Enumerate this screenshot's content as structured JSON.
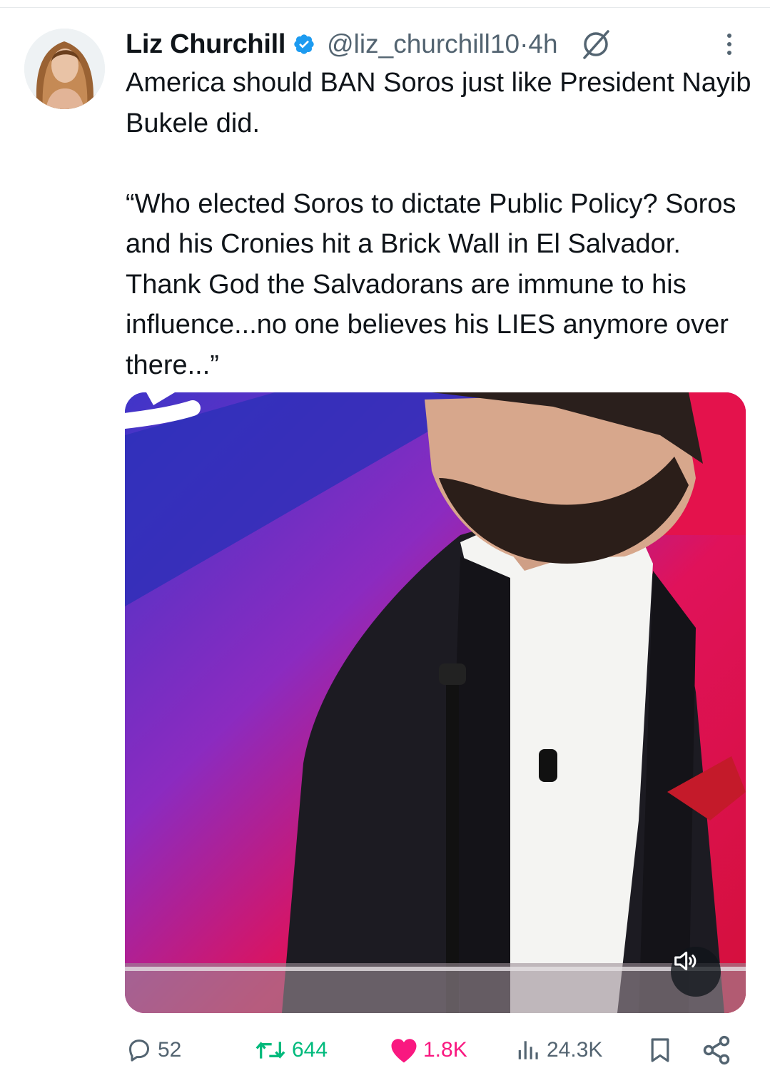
{
  "author": {
    "name": "Liz Churchill",
    "handle": "@liz_churchill10",
    "separator": " · ",
    "time": "4h"
  },
  "tweet": {
    "text": "America should BAN Soros just like President Nayib Bukele did.\n\n“Who elected Soros to dictate Public Policy? Soros and his Cronies hit a Brick Wall in El Salvador. Thank God the Salvadorans are immune to his influence...no one believes his LIES anymore over there...”"
  },
  "stats": {
    "replies": "52",
    "reposts": "644",
    "likes": "1.8K",
    "views": "24.3K"
  },
  "icons": {
    "verified": "verified-badge-icon",
    "grok": "grok-icon",
    "more": "more-vertical-icon",
    "mute": "volume-icon",
    "reply": "reply-icon",
    "repost": "repost-icon",
    "like": "heart-icon",
    "views": "views-icon",
    "bookmark": "bookmark-icon",
    "share": "share-icon"
  },
  "colors": {
    "text": "#0f1419",
    "muted": "#536471",
    "verified": "#1d9bf0",
    "repost_active": "#00ba7c",
    "like_active": "#f91880"
  }
}
